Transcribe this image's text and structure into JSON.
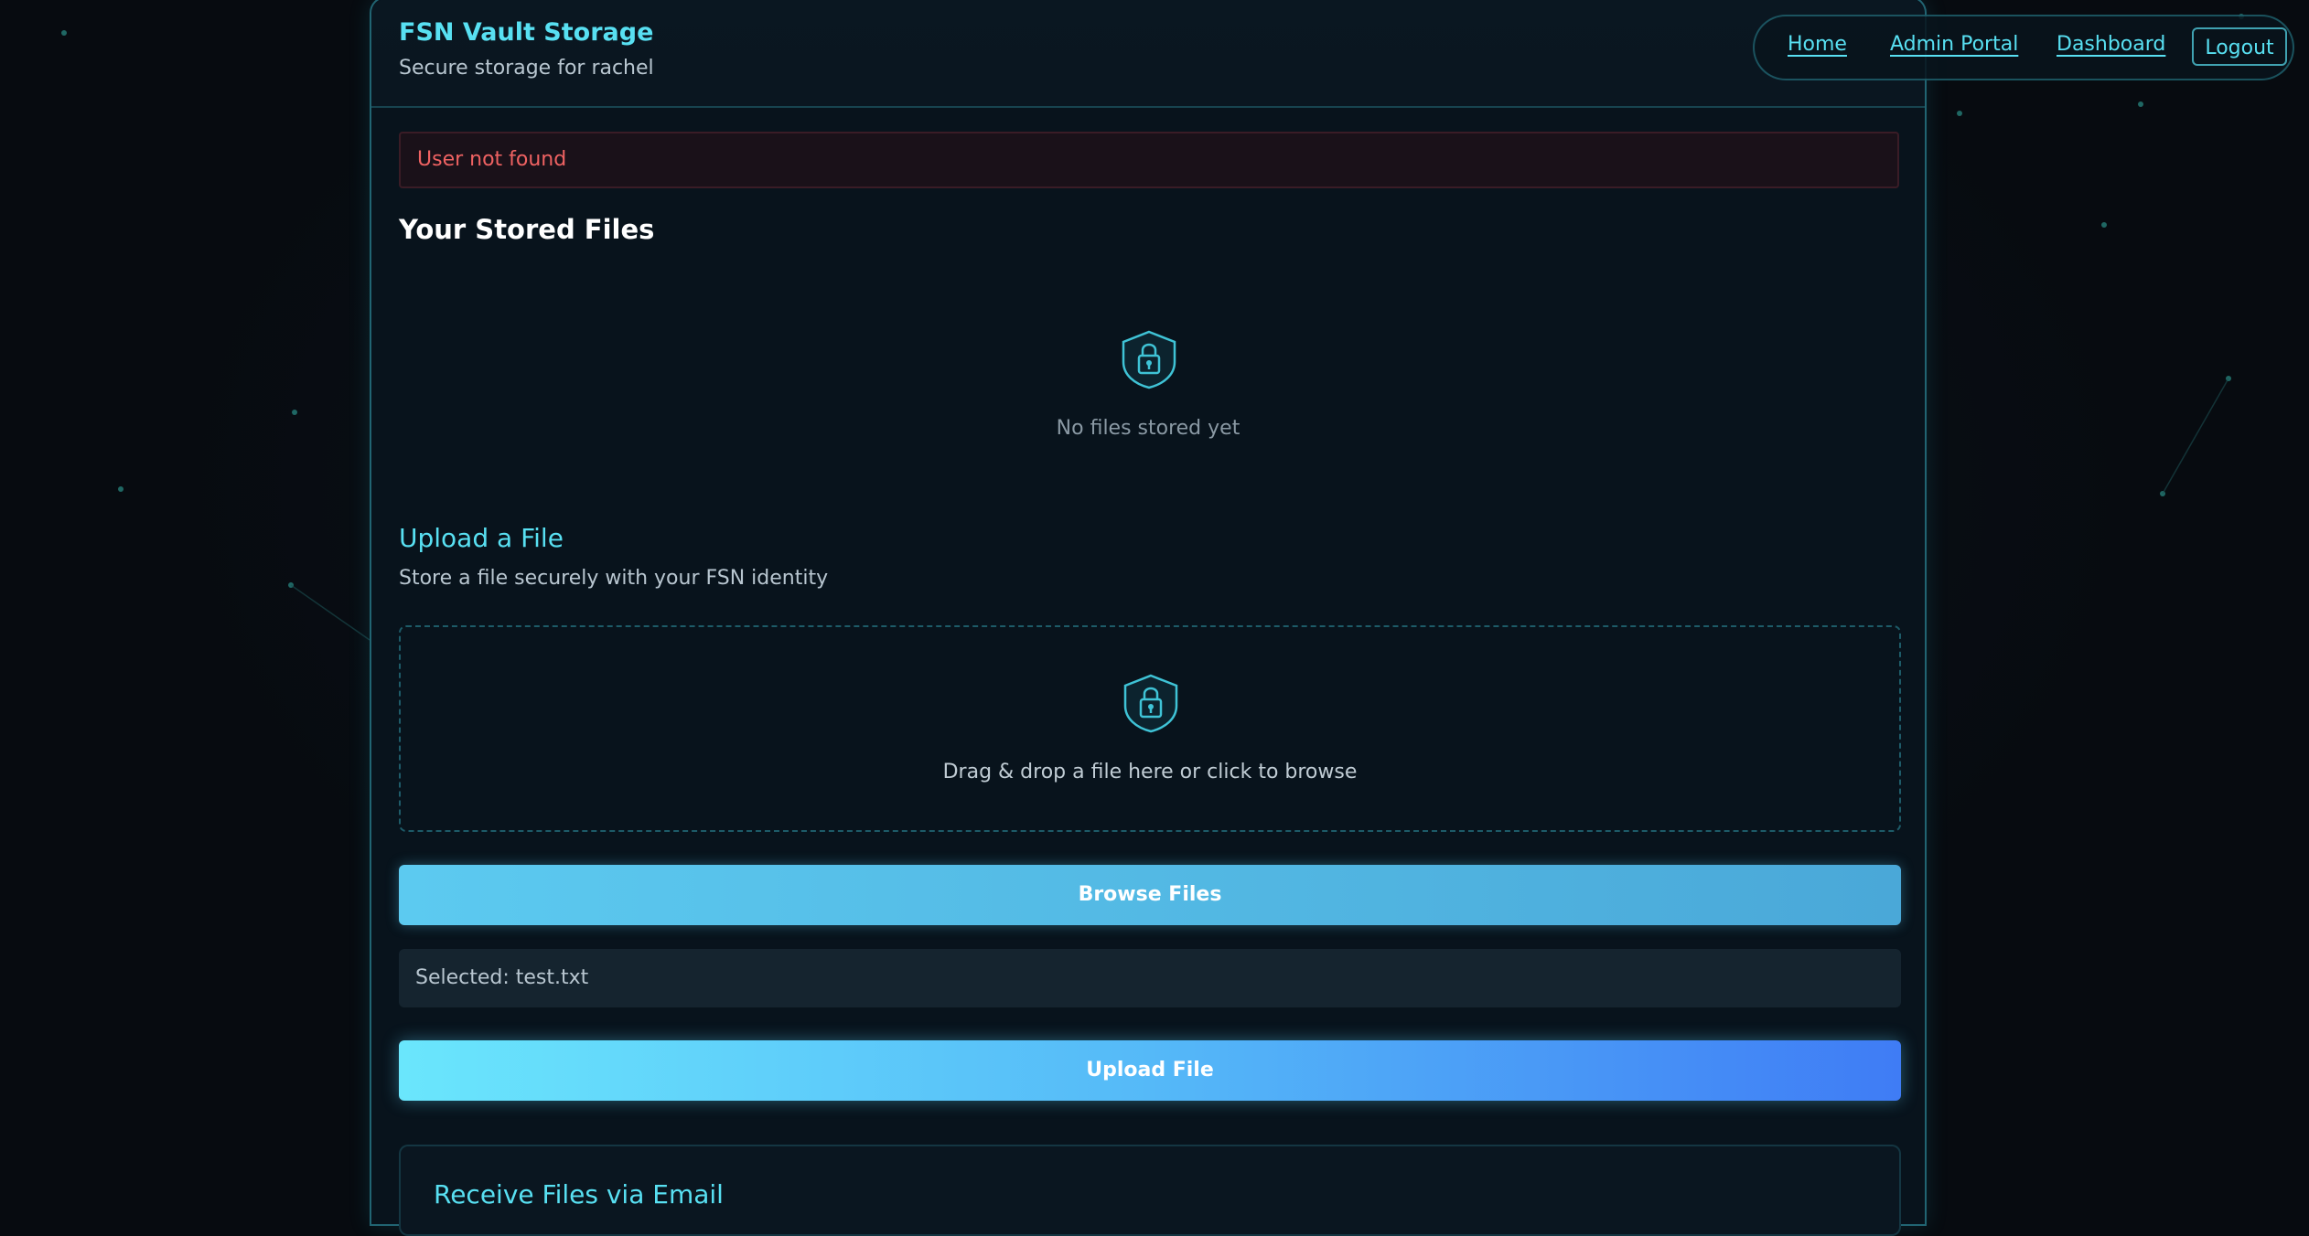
{
  "app": {
    "title": "FSN Vault Storage",
    "subtitle": "Secure storage for rachel"
  },
  "nav": {
    "items": [
      {
        "label": "Home"
      },
      {
        "label": "Admin Portal"
      },
      {
        "label": "Dashboard"
      }
    ],
    "logout_label": "Logout"
  },
  "alert": {
    "message": "User not found",
    "color": "#ef6262"
  },
  "stored_files": {
    "heading": "Your Stored Files",
    "icon": "shield-lock-icon",
    "empty_text": "No files stored yet"
  },
  "upload": {
    "heading": "Upload a File",
    "description": "Store a file securely with your FSN identity",
    "dropzone_icon": "shield-lock-icon",
    "dropzone_text": "Drag & drop a file here or click to browse",
    "browse_label": "Browse Files",
    "selected_text": "Selected: test.txt",
    "upload_label": "Upload File"
  },
  "email": {
    "heading": "Receive Files via Email"
  },
  "colors": {
    "accent": "#58e0f2",
    "background": "#070b10",
    "panel": "#08131c"
  }
}
